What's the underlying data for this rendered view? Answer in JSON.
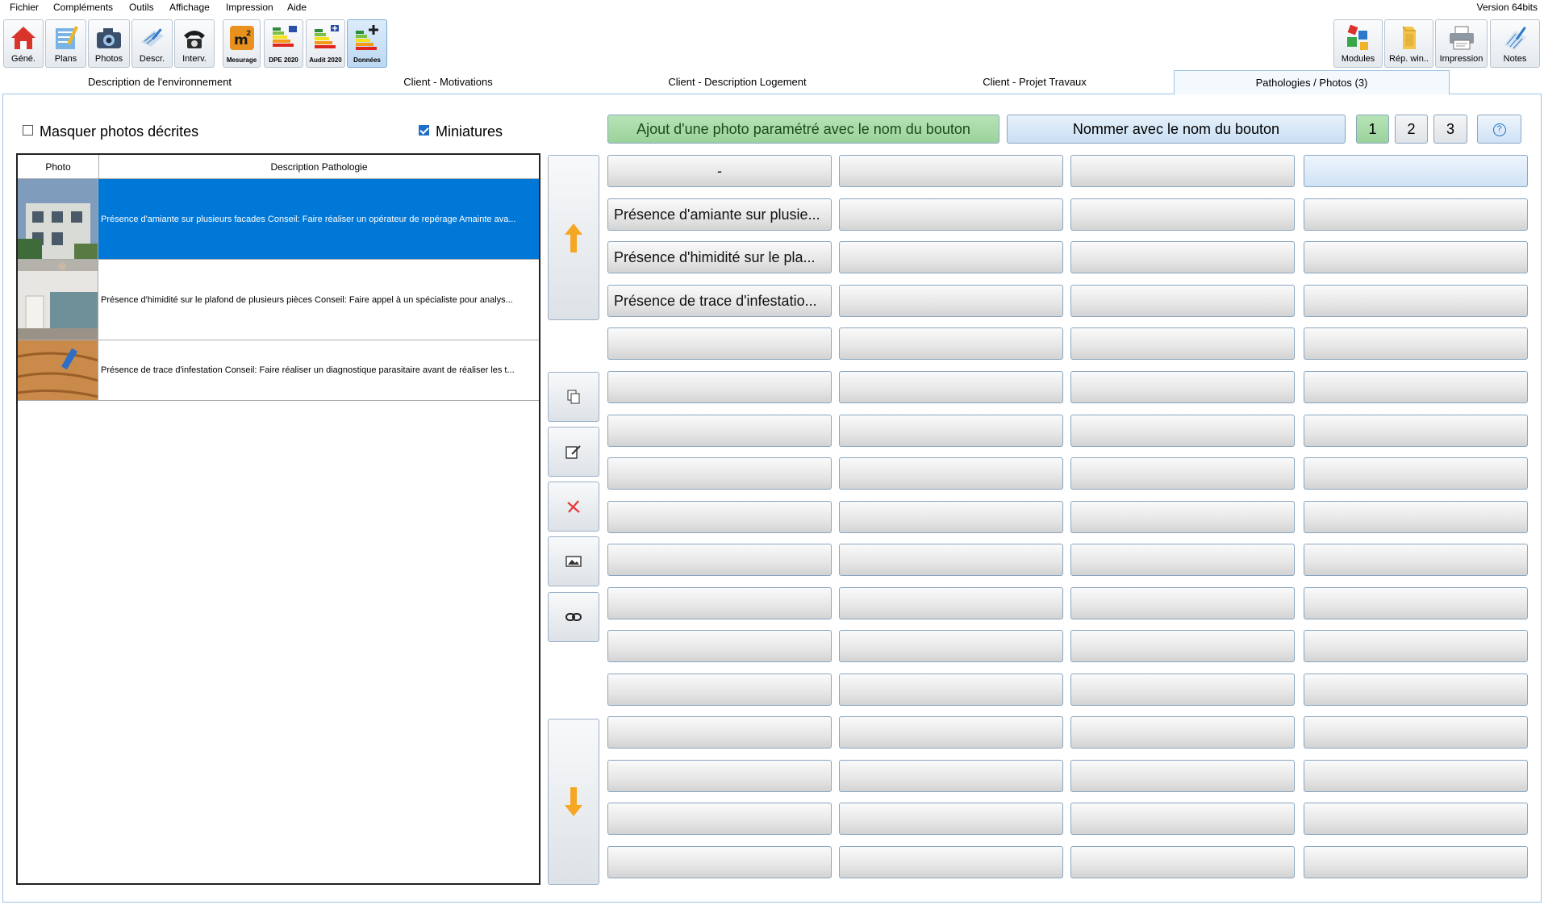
{
  "menu": [
    "Fichier",
    "Compléments",
    "Outils",
    "Affichage",
    "Impression",
    "Aide"
  ],
  "version": "Version 64bits",
  "toolbar_left": [
    {
      "label": "Géné.",
      "icon": "house-icon"
    },
    {
      "label": "Plans",
      "icon": "plans-icon"
    },
    {
      "label": "Photos",
      "icon": "camera-icon"
    },
    {
      "label": "Descr.",
      "icon": "description-icon"
    },
    {
      "label": "Interv.",
      "icon": "telephone-icon"
    }
  ],
  "toolbar_modules": [
    {
      "label": "Mesurage",
      "icon": "m2-icon"
    },
    {
      "label": "DPE 2020",
      "icon": "dpe-icon"
    },
    {
      "label": "Audit 2020",
      "icon": "audit-icon"
    },
    {
      "label": "Données",
      "icon": "data-plus-icon"
    }
  ],
  "toolbar_right": [
    {
      "label": "Modules",
      "icon": "modules-icon"
    },
    {
      "label": "Rép. win..",
      "icon": "folder-icon"
    },
    {
      "label": "Impression",
      "icon": "printer-icon"
    },
    {
      "label": "Notes",
      "icon": "notes-icon"
    }
  ],
  "tabs": [
    "Description de l'environnement",
    "Client - Motivations",
    "Client - Description Logement",
    "Client - Projet Travaux",
    "Pathologies / Photos (3)"
  ],
  "options": {
    "hide_described": "Masquer photos décrites",
    "thumbnails": "Miniatures"
  },
  "table": {
    "col_photo": "Photo",
    "col_desc": "Description Pathologie",
    "rows": [
      {
        "desc": "Présence d'amiante sur plusieurs facades Conseil: Faire réaliser un opérateur de repérage Amainte ava..."
      },
      {
        "desc": "Présence d'himidité sur le plafond de plusieurs pièces Conseil: Faire appel à un spécialiste pour analys..."
      },
      {
        "desc": "Présence de trace d'infestation Conseil: Faire réaliser un diagnostique parasitaire avant de réaliser les t..."
      }
    ]
  },
  "actions": {
    "add_photo": "Ajout d'une photo paramétré avec le nom du bouton",
    "rename": "Nommer avec le nom du bouton",
    "page1": "1",
    "page2": "2",
    "page3": "3",
    "help": "?"
  },
  "grid": {
    "r0c0": "-",
    "r1c0": "Présence d'amiante sur plusie...",
    "r2c0": "Présence d'himidité sur le pla...",
    "r3c0": "Présence de trace d'infestatio..."
  },
  "colors": {
    "accent": "#0078d7",
    "green_button": "#a5d6a7",
    "up_down_arrow": "#f5a623",
    "delete_red": "#e53935"
  }
}
